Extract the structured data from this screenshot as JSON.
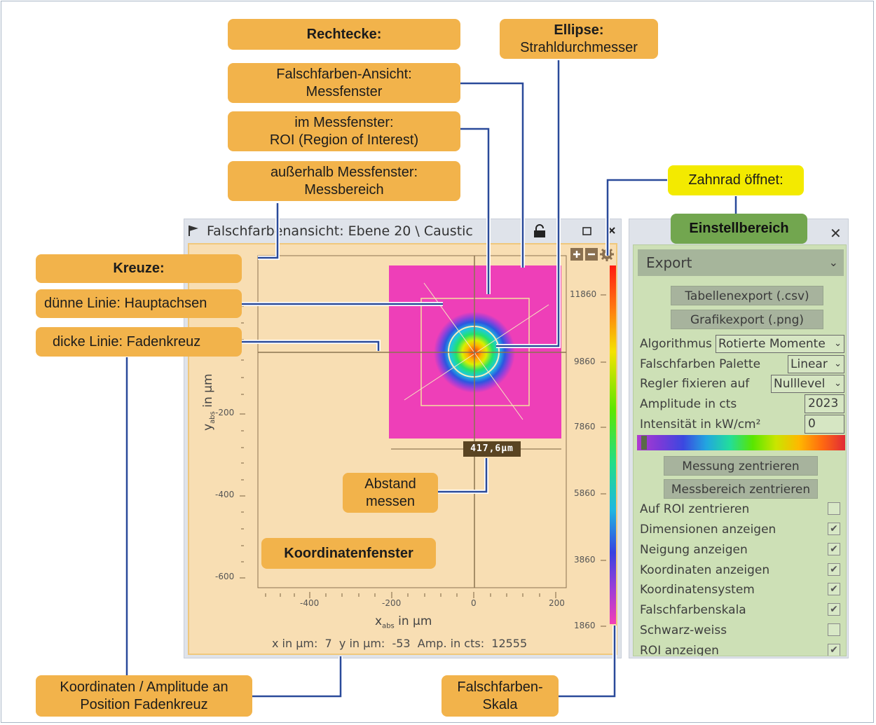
{
  "callouts": {
    "rechtecke": "Rechtecke:",
    "falschfarben_line1": "Falschfarben-Ansicht:",
    "falschfarben_line2": "Messfenster",
    "roi_line1": "im Messfenster:",
    "roi_line2": "ROI (Region of Interest)",
    "ausser_line1": "außerhalb Messfenster:",
    "ausser_line2": "Messbereich",
    "ellipse_line1": "Ellipse:",
    "ellipse_line2": "Strahldurchmesser",
    "zahnrad": "Zahnrad öffnet:",
    "einstellbereich": "Einstellbereich",
    "kreuze": "Kreuze:",
    "duenne": "dünne Linie: Hauptachsen",
    "dicke": "dicke Linie: Fadenkreuz",
    "abstand_line1": "Abstand",
    "abstand_line2": "messen",
    "koordinatenfenster": "Koordinatenfenster",
    "koord_line1": "Koordinaten / Amplitude an",
    "koord_line2": "Position Fadenkreuz",
    "skala_line1": "Falschfarben-",
    "skala_line2": "Skala"
  },
  "window": {
    "title": "Falschfarbenansicht: Ebene 20 \\ Caustic",
    "distance": "417,6µm",
    "status": "x in µm:  7  y in µm:  -53  Amp. in cts:  12555",
    "x_axis_label_sub": "abs",
    "x_axis_label_main": "x",
    "x_axis_label_rest": " in µm",
    "y_axis_label_main": "y",
    "y_axis_label_sub": "abs",
    "y_axis_label_rest": " in µm",
    "x_ticks": [
      "-400",
      "-200",
      "0",
      "200"
    ],
    "y_ticks": [
      "-200",
      "-400",
      "-600"
    ],
    "scale_ticks": [
      "11860",
      "9860",
      "7860",
      "5860",
      "3860",
      "1860"
    ]
  },
  "settings": {
    "section": "Export",
    "btn_csv": "Tabellenexport (.csv)",
    "btn_png": "Grafikexport (.png)",
    "algorithmus_label": "Algorithmus",
    "algorithmus_value": "Rotierte Momente",
    "palette_label": "Falschfarben Palette",
    "palette_value": "Linear",
    "regler_label": "Regler fixieren auf",
    "regler_value": "Nulllevel",
    "amplitude_label": "Amplitude in cts",
    "amplitude_value": "2023",
    "intensitaet_label": "Intensität in kW/cm²",
    "intensitaet_value": "0",
    "btn_messung": "Messung zentrieren",
    "btn_messbereich": "Messbereich zentrieren",
    "checks": [
      {
        "label": "Auf ROI zentrieren",
        "checked": false
      },
      {
        "label": "Dimensionen anzeigen",
        "checked": true
      },
      {
        "label": "Neigung anzeigen",
        "checked": true
      },
      {
        "label": "Koordinaten anzeigen",
        "checked": true
      },
      {
        "label": "Koordinatensystem",
        "checked": true
      },
      {
        "label": "Falschfarbenskala",
        "checked": true
      },
      {
        "label": "Schwarz-weiss",
        "checked": false
      },
      {
        "label": "ROI anzeigen",
        "checked": true
      }
    ]
  },
  "colors": {
    "callout": "#f2b34b",
    "callout_yellow": "#f3ea00",
    "callout_green": "#72a64f",
    "connector": "#2a4a9a",
    "messfenster": "#ee3fb8"
  }
}
